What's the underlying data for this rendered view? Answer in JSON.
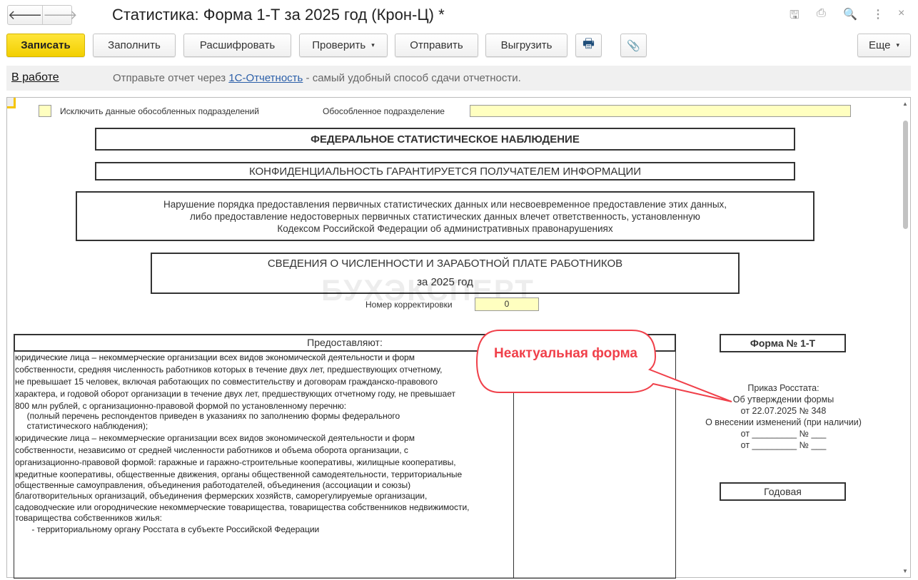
{
  "window": {
    "title": "Статистика: Форма 1-Т за 2025 год (Крон-Ц) *",
    "back_icon": "arrow-left",
    "forward_icon": "arrow-right"
  },
  "toolbar": {
    "save": "Записать",
    "fill": "Заполнить",
    "decode": "Расшифровать",
    "check": "Проверить",
    "send": "Отправить",
    "export": "Выгрузить",
    "more": "Еще",
    "dropdown_glyph": "▾"
  },
  "infobar": {
    "status": "В работе",
    "text_before": "Отправьте отчет через ",
    "link": "1С-Отчетность",
    "text_after": " - самый удобный способ сдачи отчетности."
  },
  "form": {
    "exclude_label": "Исключить данные обособленных подразделений",
    "subdivision_label": "Обособленное подразделение",
    "subdivision_value": "",
    "federal": "ФЕДЕРАЛЬНОЕ СТАТИСТИЧЕСКОЕ НАБЛЮДЕНИЕ",
    "confidential": "КОНФИДЕНЦИАЛЬНОСТЬ ГАРАНТИРУЕТСЯ ПОЛУЧАТЕЛЕМ ИНФОРМАЦИИ",
    "warning": [
      "Нарушение порядка предоставления первичных статистических данных или несвоевременное предоставление этих данных,",
      "либо предоставление недостоверных первичных статистических данных влечет ответственность, установленную",
      "Кодексом Российской Федерации об административных правонарушениях"
    ],
    "report_title": "СВЕДЕНИЯ О ЧИСЛЕННОСТИ И ЗАРАБОТНОЙ ПЛАТЕ РАБОТНИКОВ",
    "report_period": "за 2025 год",
    "correction_label": "Номер корректировки",
    "correction_value": "0",
    "provide_header": "Предоставляют:",
    "provide_lines": [
      "юридические лица – некоммерческие организации всех видов экономической деятельности и форм",
      "собственности, средняя численность работников которых в течение двух лет, предшествующих отчетному,",
      "не превышает 15 человек, включая работающих по совместительству и договорам гражданско-правового",
      "характера, и годовой оборот организации в течение двух лет, предшествующих отчетному году, не превышает",
      "800 млн рублей, с организационно-правовой формой по установленному перечню:",
      "     (полный перечень респондентов приведен в указаниях по заполнению формы федерального",
      "     статистического наблюдения);",
      "юридические лица – некоммерческие организации всех видов экономической деятельности и форм",
      "собственности, независимо от средней численности работников и объема оборота организации, с",
      "организационно-правовой формой: гаражные и гаражно-строительные кооперативы, жилищные кооперативы,",
      "кредитные кооперативы, общественные движения, органы общественной самодеятельности, территориальные",
      "общественные самоуправления, объединения работодателей, объединения (ассоциации и союзы)",
      "благотворительных организаций, объединения фермерских хозяйств, саморегулируемые организации,",
      "садоводческие или огороднические некоммерческие товарищества, товарищества собственников недвижимости,",
      "товарищества собственников жилья:",
      "       - территориальному органу Росстата в субъекте Российской Федерации"
    ],
    "form_no": "Форма № 1-Т",
    "order": [
      "Приказ Росстата:",
      "Об утверждении формы",
      "от 22.07.2025 № 348",
      "О внесении изменений (при наличии)",
      "от _________ № ___",
      "от _________ № ___"
    ],
    "periodicity": "Годовая",
    "watermark": "БУХЭКСПЕРТ"
  },
  "callout": {
    "text": "Неактуальная форма",
    "color": "#f0404a"
  }
}
